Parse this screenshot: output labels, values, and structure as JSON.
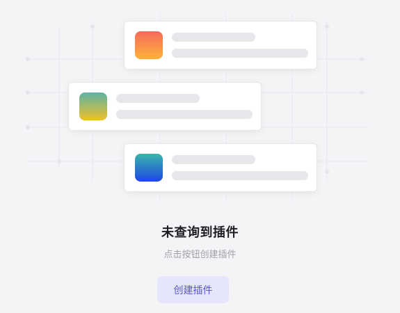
{
  "illustration": {
    "cards": [
      {
        "icon": "orange-gradient-app-icon",
        "color_top": "#f56a5b",
        "color_bottom": "#ffb13b"
      },
      {
        "icon": "green-yellow-gradient-app-icon",
        "color_top": "#5db3a4",
        "color_bottom": "#f0c02a"
      },
      {
        "icon": "teal-blue-gradient-app-icon",
        "color_top": "#3bb5a8",
        "color_bottom": "#1d46e6"
      }
    ]
  },
  "empty_state": {
    "title": "未查询到插件",
    "subtitle": "点击按钮创建插件",
    "button_label": "创建插件"
  },
  "colors": {
    "background": "#f4f4f6",
    "accent": "#5a55d8",
    "button_bg": "#e5e6fa"
  }
}
